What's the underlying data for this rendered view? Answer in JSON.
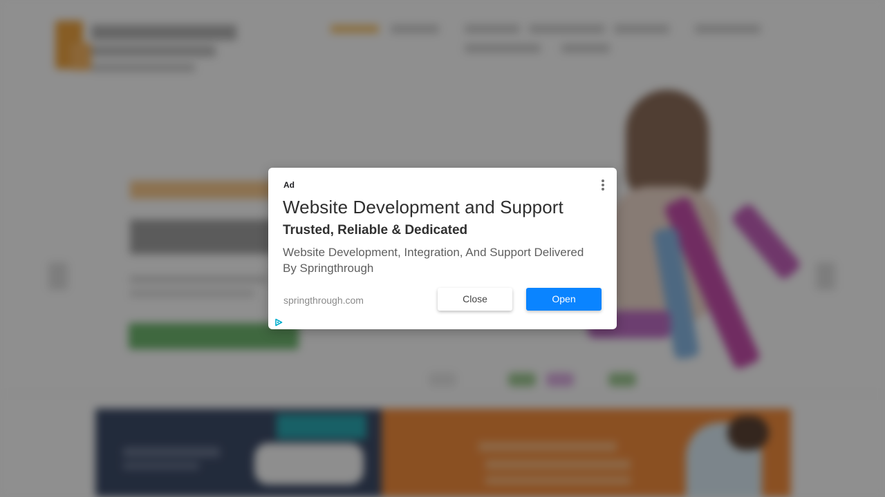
{
  "ad": {
    "label": "Ad",
    "headline": "Website Development and Support",
    "subheadline": "Trusted, Reliable & Dedicated",
    "description": "Website Development, Integration, And Support Delivered By Springthrough",
    "domain": "springthrough.com",
    "close_label": "Close",
    "open_label": "Open",
    "menu_icon": "more-vertical-icon",
    "adchoices_icon": "adchoices-icon"
  },
  "colors": {
    "open_button": "#0a84ff",
    "overlay": "rgba(0,0,0,0.42)",
    "adchoices": "#00aecd"
  }
}
